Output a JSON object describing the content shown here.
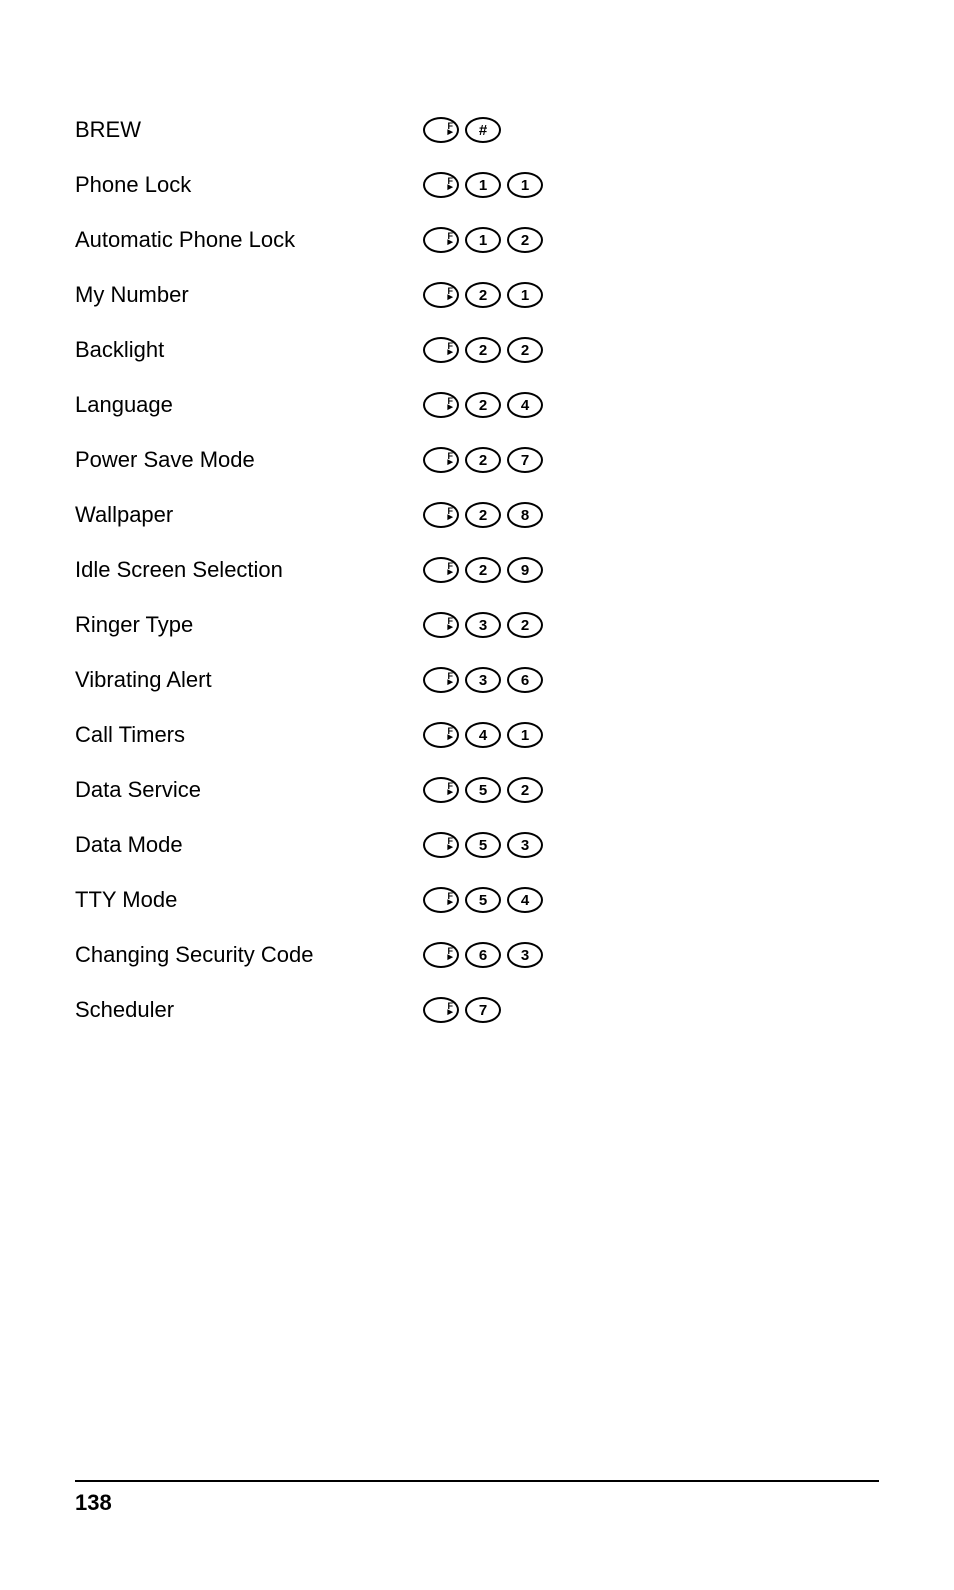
{
  "rows": [
    {
      "label": "BREW",
      "keys": [
        "F",
        "#"
      ]
    },
    {
      "label": "Phone Lock",
      "keys": [
        "F",
        "1",
        "1"
      ]
    },
    {
      "label": "Automatic Phone Lock",
      "keys": [
        "F",
        "1",
        "2"
      ]
    },
    {
      "label": "My Number",
      "keys": [
        "F",
        "2",
        "1"
      ]
    },
    {
      "label": "Backlight",
      "keys": [
        "F",
        "2",
        "2"
      ]
    },
    {
      "label": "Language",
      "keys": [
        "F",
        "2",
        "4"
      ]
    },
    {
      "label": "Power Save Mode",
      "keys": [
        "F",
        "2",
        "7"
      ]
    },
    {
      "label": "Wallpaper",
      "keys": [
        "F",
        "2",
        "8"
      ]
    },
    {
      "label": "Idle Screen Selection",
      "keys": [
        "F",
        "2",
        "9"
      ]
    },
    {
      "label": "Ringer Type",
      "keys": [
        "F",
        "3",
        "2"
      ]
    },
    {
      "label": "Vibrating Alert",
      "keys": [
        "F",
        "3",
        "6"
      ]
    },
    {
      "label": "Call Timers",
      "keys": [
        "F",
        "4",
        "1"
      ]
    },
    {
      "label": "Data Service",
      "keys": [
        "F",
        "5",
        "2"
      ]
    },
    {
      "label": "Data Mode",
      "keys": [
        "F",
        "5",
        "3"
      ]
    },
    {
      "label": "TTY Mode",
      "keys": [
        "F",
        "5",
        "4"
      ]
    },
    {
      "label": "Changing Security Code",
      "keys": [
        "F",
        "6",
        "3"
      ]
    },
    {
      "label": "Scheduler",
      "keys": [
        "F",
        "7"
      ]
    }
  ],
  "page_number": "138"
}
